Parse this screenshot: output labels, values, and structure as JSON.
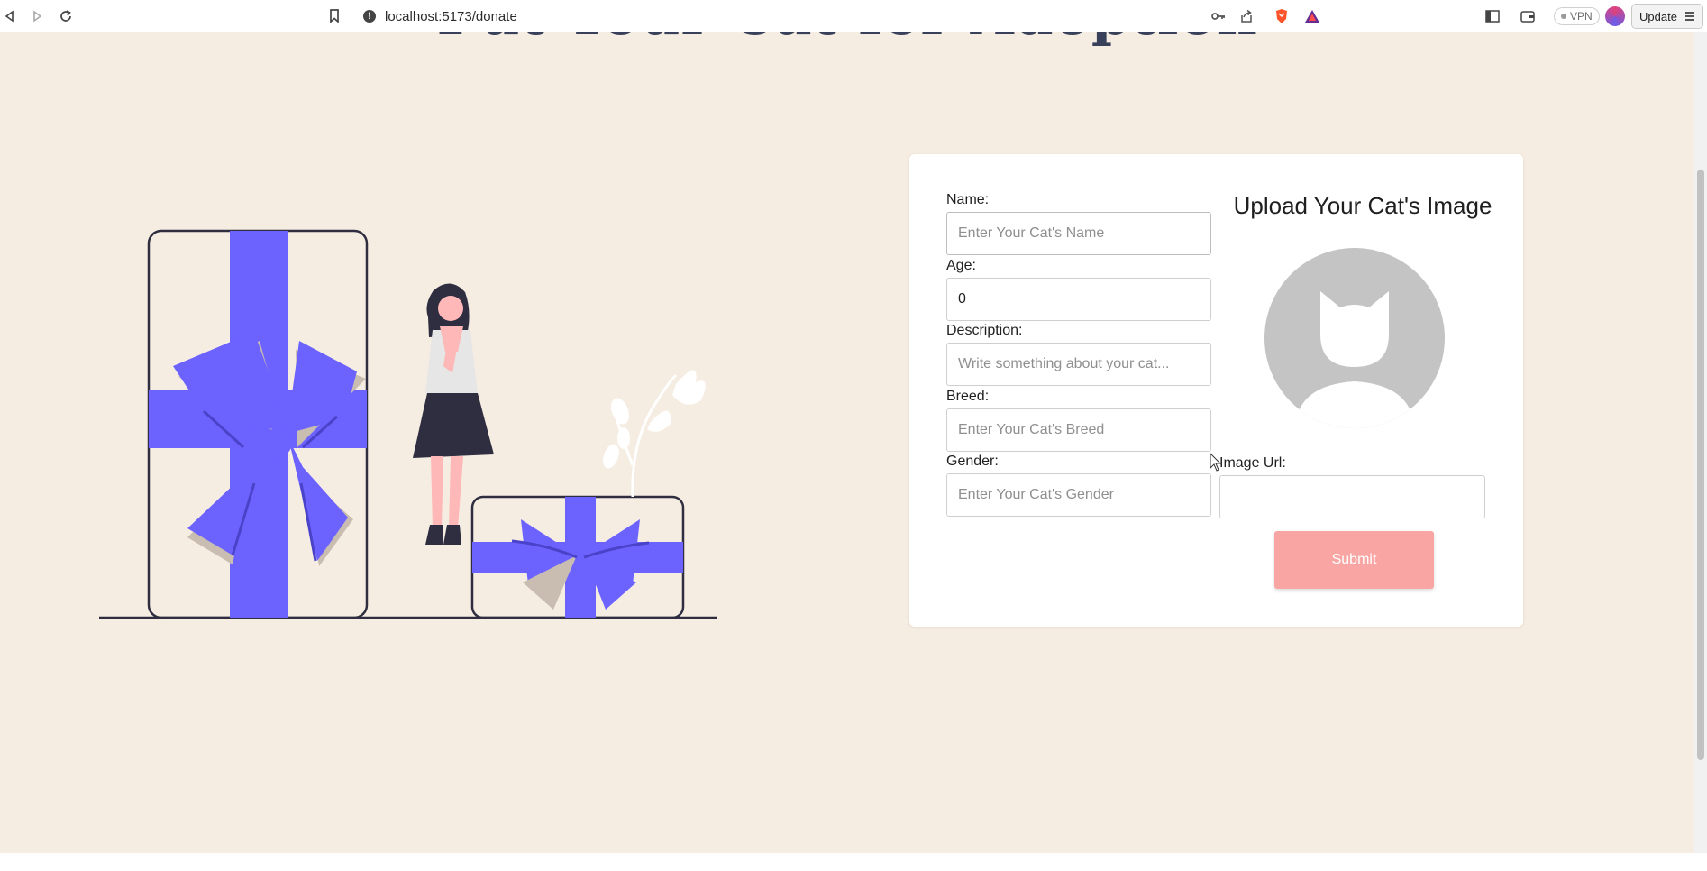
{
  "browser": {
    "url": "localhost:5173/donate",
    "vpn_label": "VPN",
    "update_label": "Update"
  },
  "page": {
    "title": "Put Your Cat for Adoption"
  },
  "form": {
    "name": {
      "label": "Name:",
      "placeholder": "Enter Your Cat's Name",
      "value": ""
    },
    "age": {
      "label": "Age:",
      "placeholder": "",
      "value": "0"
    },
    "description": {
      "label": "Description:",
      "placeholder": "Write something about your cat...",
      "value": ""
    },
    "breed": {
      "label": "Breed:",
      "placeholder": "Enter Your Cat's Breed",
      "value": ""
    },
    "gender": {
      "label": "Gender:",
      "placeholder": "Enter Your Cat's Gender",
      "value": ""
    },
    "upload_title": "Upload Your Cat's Image",
    "image_url": {
      "label": "Image Url:",
      "value": ""
    },
    "submit_label": "Submit"
  },
  "colors": {
    "page_background": "#f6ede2",
    "title": "#39405a",
    "illustration_accent": "#6c63ff",
    "illustration_skin": "#ffb8b8",
    "submit_button": "#f8a5a4",
    "avatar": "#c4c4c4"
  },
  "icons": [
    "back-icon",
    "forward-icon",
    "reload-icon",
    "bookmark-icon",
    "info-icon",
    "key-icon",
    "share-icon",
    "brave-shield-icon",
    "brave-rewards-icon",
    "sidebar-icon",
    "wallet-icon",
    "menu-icon"
  ]
}
